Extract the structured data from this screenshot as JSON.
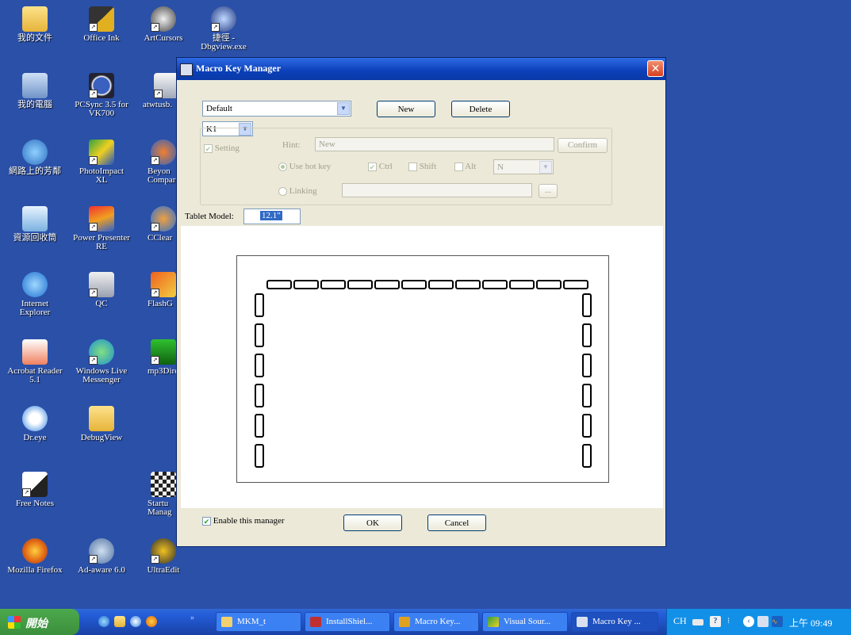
{
  "desktop": {
    "icons": [
      {
        "label": "我的文件"
      },
      {
        "label": "Office Ink"
      },
      {
        "label": "ArtCursors"
      },
      {
        "label": "捷徑 -\nDbgview.exe"
      },
      {
        "label": "我的電腦"
      },
      {
        "label": "PCSync 3.5 for\nVK700"
      },
      {
        "label": "atwtusb."
      },
      {
        "label": "網路上的芳鄰"
      },
      {
        "label": "PhotoImpact\nXL"
      },
      {
        "label": "Beyon\nCompar"
      },
      {
        "label": "資源回收筒"
      },
      {
        "label": "Power Presenter\nRE"
      },
      {
        "label": "CClear"
      },
      {
        "label": "Internet\nExplorer"
      },
      {
        "label": "QC"
      },
      {
        "label": "FlashG"
      },
      {
        "label": "Acrobat Reader\n5.1"
      },
      {
        "label": "Windows Live\nMessenger"
      },
      {
        "label": "mp3Direc"
      },
      {
        "label": "Dr.eye"
      },
      {
        "label": "DebugView"
      },
      {
        "label": "Free Notes"
      },
      {
        "label": "Startu\nManag"
      },
      {
        "label": "Mozilla Firefox"
      },
      {
        "label": "Ad-aware 6.0"
      },
      {
        "label": "UltraEdit"
      }
    ]
  },
  "dialog": {
    "title": "Macro Key Manager",
    "close_label": "✕",
    "profile_select": "Default",
    "new_label": "New",
    "delete_label": "Delete",
    "key_select": "K1",
    "setting_label": "Setting",
    "hint_label": "Hint:",
    "hint_value": "New",
    "confirm_label": "Confirm",
    "use_hotkey_label": "Use hot key",
    "ctrl_label": "Ctrl",
    "shift_label": "Shift",
    "alt_label": "Alt",
    "hotkey_select": "N",
    "linking_label": "Linking",
    "browse_label": "...",
    "tablet_model_label": "Tablet Model:",
    "tablet_model_value": "12.1\"",
    "enable_label": "Enable this manager",
    "ok_label": "OK",
    "cancel_label": "Cancel",
    "top_key_count": 12,
    "side_key_count": 6
  },
  "taskbar": {
    "start_label": "開始",
    "tasks": [
      {
        "label": "MKM_t"
      },
      {
        "label": "InstallShiel..."
      },
      {
        "label": "Macro Key..."
      },
      {
        "label": "Visual Sour..."
      },
      {
        "label": "Macro Key ..."
      }
    ],
    "lang": "CH",
    "clock": "上午 09:49"
  }
}
